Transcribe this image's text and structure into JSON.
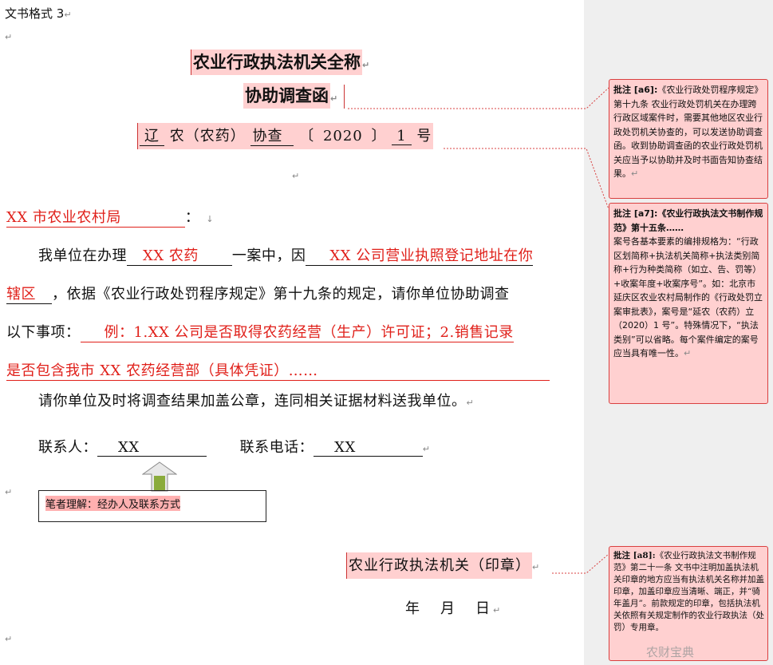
{
  "doc": {
    "header_label": "文书格式 3",
    "title_line1": "农业行政执法机关全称",
    "title_line2": "协助调查函",
    "number": {
      "region": "辽",
      "mid": "农（农药）",
      "type": "协查",
      "year_open": "〔",
      "year": "2020",
      "year_close": "〕",
      "seq": "1",
      "suffix": "号"
    },
    "recipient": "XX 市农业农村局",
    "recipient_suffix": "：",
    "para1": {
      "prefix": "我单位在办理",
      "case": "XX 农药",
      "mid": "一案中，因",
      "reason_a": "XX 公司营业执照登记地址在你",
      "reason_b": "辖区",
      "tail_b": "，依据《农业行政处罚程序规定》第十九条的规定，请你单位协助调查",
      "prefix_c": "以下事项：",
      "items_c": "例：1.XX 公司是否取得农药经营（生产）许可证；2.销售记录",
      "items_d": "是否包含我市 XX 农药经营部（具体凭证）……"
    },
    "para2": "请你单位及时将调查结果加盖公章，连同相关证据材料送我单位。",
    "contact_label": "联系人：",
    "contact_value": "XX",
    "phone_label": "联系电话：",
    "phone_value": "XX",
    "note": "笔者理解：经办人及联系方式",
    "seal": "农业行政执法机关（印章）",
    "date": "年　月　日"
  },
  "comments": {
    "a6": {
      "tag": "批注 [a6]:",
      "text": "《农业行政处罚程序规定》第十九条 农业行政处罚机关在办理跨行政区域案件时，需要其他地区农业行政处罚机关协查的，可以发送协助调查函。收到协助调查函的农业行政处罚机关应当予以协助并及时书面告知协查结果。"
    },
    "a7": {
      "tag": "批注 [a7]:",
      "text_bold": "《农业行政执法文书制作规范》第十五条……",
      "text": "案号各基本要素的编排规格为：“行政区划简称+执法机关简称+执法类别简称+行为种类简称（如立、告、罚等）+收案年度+收案序号”。如：北京市延庆区农业农村局制作的《行政处罚立案审批表》，案号是“延农（农药）立（2020）1 号”。特殊情况下，“执法类别”可以省略。每个案件编定的案号应当具有唯一性。"
    },
    "a8": {
      "tag": "批注 [a8]:",
      "text": "《农业行政执法文书制作规范》第二十一条 文书中注明加盖执法机关印章的地方应当有执法机关名称并加盖印章，加盖印章应当清晰、端正，并“骑年盖月”。前款规定的印章，包括执法机关依照有关规定制作的农业行政执法（处罚）专用章。"
    }
  },
  "watermark": "农财宝典"
}
